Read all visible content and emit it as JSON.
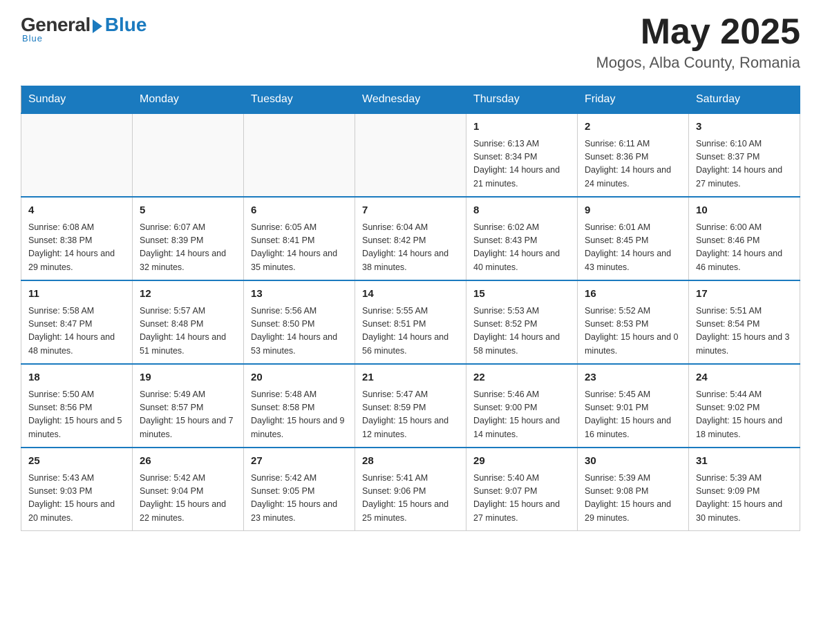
{
  "header": {
    "logo_general": "General",
    "logo_blue": "Blue",
    "logo_bottom": "Blue",
    "month_title": "May 2025",
    "location": "Mogos, Alba County, Romania"
  },
  "days_of_week": [
    "Sunday",
    "Monday",
    "Tuesday",
    "Wednesday",
    "Thursday",
    "Friday",
    "Saturday"
  ],
  "weeks": [
    {
      "days": [
        {
          "number": "",
          "info": ""
        },
        {
          "number": "",
          "info": ""
        },
        {
          "number": "",
          "info": ""
        },
        {
          "number": "",
          "info": ""
        },
        {
          "number": "1",
          "info": "Sunrise: 6:13 AM\nSunset: 8:34 PM\nDaylight: 14 hours and 21 minutes."
        },
        {
          "number": "2",
          "info": "Sunrise: 6:11 AM\nSunset: 8:36 PM\nDaylight: 14 hours and 24 minutes."
        },
        {
          "number": "3",
          "info": "Sunrise: 6:10 AM\nSunset: 8:37 PM\nDaylight: 14 hours and 27 minutes."
        }
      ]
    },
    {
      "days": [
        {
          "number": "4",
          "info": "Sunrise: 6:08 AM\nSunset: 8:38 PM\nDaylight: 14 hours and 29 minutes."
        },
        {
          "number": "5",
          "info": "Sunrise: 6:07 AM\nSunset: 8:39 PM\nDaylight: 14 hours and 32 minutes."
        },
        {
          "number": "6",
          "info": "Sunrise: 6:05 AM\nSunset: 8:41 PM\nDaylight: 14 hours and 35 minutes."
        },
        {
          "number": "7",
          "info": "Sunrise: 6:04 AM\nSunset: 8:42 PM\nDaylight: 14 hours and 38 minutes."
        },
        {
          "number": "8",
          "info": "Sunrise: 6:02 AM\nSunset: 8:43 PM\nDaylight: 14 hours and 40 minutes."
        },
        {
          "number": "9",
          "info": "Sunrise: 6:01 AM\nSunset: 8:45 PM\nDaylight: 14 hours and 43 minutes."
        },
        {
          "number": "10",
          "info": "Sunrise: 6:00 AM\nSunset: 8:46 PM\nDaylight: 14 hours and 46 minutes."
        }
      ]
    },
    {
      "days": [
        {
          "number": "11",
          "info": "Sunrise: 5:58 AM\nSunset: 8:47 PM\nDaylight: 14 hours and 48 minutes."
        },
        {
          "number": "12",
          "info": "Sunrise: 5:57 AM\nSunset: 8:48 PM\nDaylight: 14 hours and 51 minutes."
        },
        {
          "number": "13",
          "info": "Sunrise: 5:56 AM\nSunset: 8:50 PM\nDaylight: 14 hours and 53 minutes."
        },
        {
          "number": "14",
          "info": "Sunrise: 5:55 AM\nSunset: 8:51 PM\nDaylight: 14 hours and 56 minutes."
        },
        {
          "number": "15",
          "info": "Sunrise: 5:53 AM\nSunset: 8:52 PM\nDaylight: 14 hours and 58 minutes."
        },
        {
          "number": "16",
          "info": "Sunrise: 5:52 AM\nSunset: 8:53 PM\nDaylight: 15 hours and 0 minutes."
        },
        {
          "number": "17",
          "info": "Sunrise: 5:51 AM\nSunset: 8:54 PM\nDaylight: 15 hours and 3 minutes."
        }
      ]
    },
    {
      "days": [
        {
          "number": "18",
          "info": "Sunrise: 5:50 AM\nSunset: 8:56 PM\nDaylight: 15 hours and 5 minutes."
        },
        {
          "number": "19",
          "info": "Sunrise: 5:49 AM\nSunset: 8:57 PM\nDaylight: 15 hours and 7 minutes."
        },
        {
          "number": "20",
          "info": "Sunrise: 5:48 AM\nSunset: 8:58 PM\nDaylight: 15 hours and 9 minutes."
        },
        {
          "number": "21",
          "info": "Sunrise: 5:47 AM\nSunset: 8:59 PM\nDaylight: 15 hours and 12 minutes."
        },
        {
          "number": "22",
          "info": "Sunrise: 5:46 AM\nSunset: 9:00 PM\nDaylight: 15 hours and 14 minutes."
        },
        {
          "number": "23",
          "info": "Sunrise: 5:45 AM\nSunset: 9:01 PM\nDaylight: 15 hours and 16 minutes."
        },
        {
          "number": "24",
          "info": "Sunrise: 5:44 AM\nSunset: 9:02 PM\nDaylight: 15 hours and 18 minutes."
        }
      ]
    },
    {
      "days": [
        {
          "number": "25",
          "info": "Sunrise: 5:43 AM\nSunset: 9:03 PM\nDaylight: 15 hours and 20 minutes."
        },
        {
          "number": "26",
          "info": "Sunrise: 5:42 AM\nSunset: 9:04 PM\nDaylight: 15 hours and 22 minutes."
        },
        {
          "number": "27",
          "info": "Sunrise: 5:42 AM\nSunset: 9:05 PM\nDaylight: 15 hours and 23 minutes."
        },
        {
          "number": "28",
          "info": "Sunrise: 5:41 AM\nSunset: 9:06 PM\nDaylight: 15 hours and 25 minutes."
        },
        {
          "number": "29",
          "info": "Sunrise: 5:40 AM\nSunset: 9:07 PM\nDaylight: 15 hours and 27 minutes."
        },
        {
          "number": "30",
          "info": "Sunrise: 5:39 AM\nSunset: 9:08 PM\nDaylight: 15 hours and 29 minutes."
        },
        {
          "number": "31",
          "info": "Sunrise: 5:39 AM\nSunset: 9:09 PM\nDaylight: 15 hours and 30 minutes."
        }
      ]
    }
  ]
}
